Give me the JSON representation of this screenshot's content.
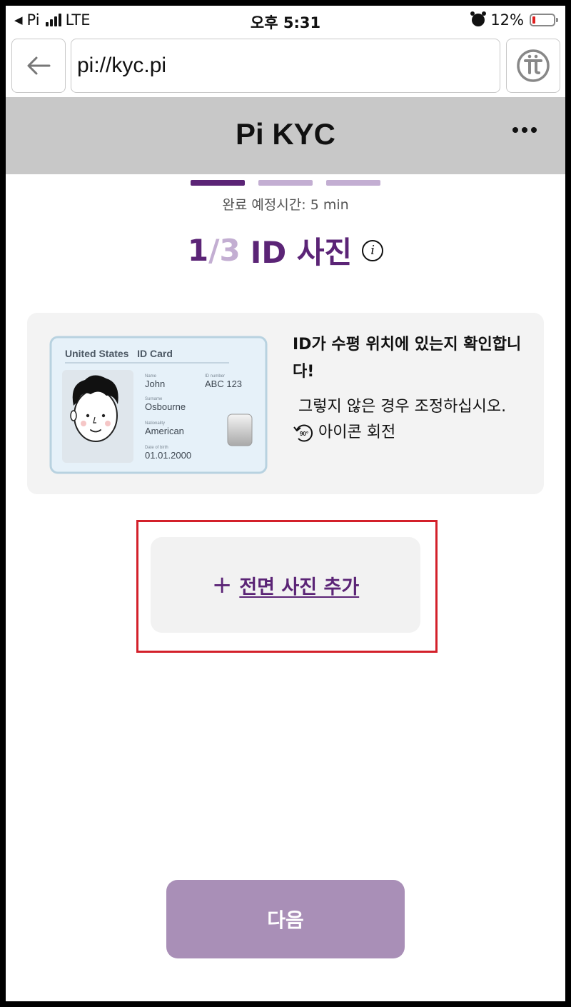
{
  "status_bar": {
    "carrier": "Pi",
    "network": "LTE",
    "time": "오후 5:31",
    "battery": "12%"
  },
  "browser": {
    "url": "pi://kyc.pi"
  },
  "header": {
    "title": "Pi KYC"
  },
  "progress": {
    "current_step": 1,
    "total_steps": 3,
    "eta": "완료 예정시간: 5 min",
    "step_num": "1",
    "step_slash": "/",
    "step_total": "3",
    "step_label": "ID 사진"
  },
  "instruction_card": {
    "id_card": {
      "header": "United States   ID Card",
      "name_label": "Name",
      "name": "John",
      "id_label": "ID number",
      "id_number": "ABC 123",
      "surname_label": "Surname",
      "surname": "Osbourne",
      "nationality_label": "Nationality",
      "nationality": "American",
      "dob_label": "Date of birth",
      "dob": "01.01.2000"
    },
    "heading": "ID가 수평 위치에 있는지 확인합니다!",
    "body": "그렇지 않은 경우 조정하십시오.",
    "rotate_badge": "90°",
    "rotate_label": "아이콘 회전"
  },
  "add_photo": {
    "label": "전면 사진 추가"
  },
  "next_button": {
    "label": "다음"
  },
  "colors": {
    "accent": "#5b2476",
    "accent_light": "#c3aed2",
    "next_button": "#a98fb7",
    "highlight": "#d3202a",
    "header_bg": "#c8c8c8"
  }
}
